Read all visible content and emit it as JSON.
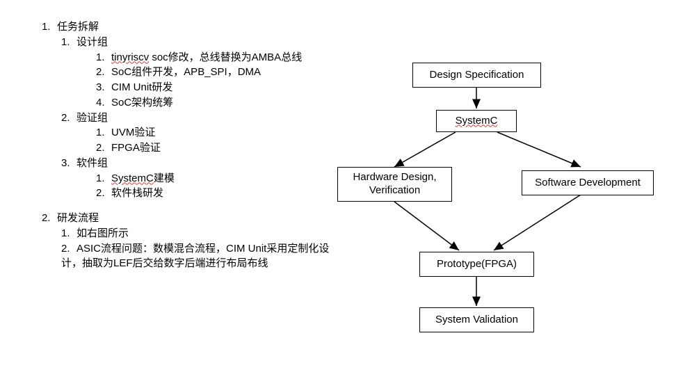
{
  "outline": {
    "items": [
      {
        "num": "1.",
        "label": "任务拆解",
        "children": [
          {
            "num": "1.",
            "label": "设计组",
            "children": [
              {
                "num": "1.",
                "label_prefix": "tinyriscv",
                "label_rest": " soc修改，总线替换为AMBA总线"
              },
              {
                "num": "2.",
                "label": "SoC组件开发，APB_SPI，DMA"
              },
              {
                "num": "3.",
                "label": "CIM Unit研发"
              },
              {
                "num": "4.",
                "label": "SoC架构统筹"
              }
            ]
          },
          {
            "num": "2.",
            "label": "验证组",
            "children": [
              {
                "num": "1.",
                "label": "UVM验证"
              },
              {
                "num": "2.",
                "label": "FPGA验证"
              }
            ]
          },
          {
            "num": "3.",
            "label": "软件组",
            "children": [
              {
                "num": "1.",
                "label_prefix": "SystemC",
                "label_rest": "建模"
              },
              {
                "num": "2.",
                "label": "软件栈研发"
              }
            ]
          }
        ]
      },
      {
        "num": "2.",
        "label": "研发流程",
        "children": [
          {
            "num": "1.",
            "label": "如右图所示"
          },
          {
            "num": "2.",
            "label": "ASIC流程问题：数模混合流程，CIM Unit采用定制化设计，抽取为LEF后交给数字后端进行布局布线"
          }
        ]
      }
    ]
  },
  "diagram": {
    "nodes": {
      "spec": "Design Specification",
      "systemc": "SystemC",
      "hw": "Hardware Design,\nVerification",
      "sw": "Software Development",
      "proto": "Prototype(FPGA)",
      "valid": "System Validation"
    }
  },
  "chart_data": {
    "type": "flowchart",
    "nodes": [
      {
        "id": "spec",
        "label": "Design Specification"
      },
      {
        "id": "systemc",
        "label": "SystemC"
      },
      {
        "id": "hw",
        "label": "Hardware Design, Verification"
      },
      {
        "id": "sw",
        "label": "Software Development"
      },
      {
        "id": "proto",
        "label": "Prototype(FPGA)"
      },
      {
        "id": "valid",
        "label": "System Validation"
      }
    ],
    "edges": [
      {
        "from": "spec",
        "to": "systemc"
      },
      {
        "from": "systemc",
        "to": "hw"
      },
      {
        "from": "systemc",
        "to": "sw"
      },
      {
        "from": "hw",
        "to": "proto"
      },
      {
        "from": "sw",
        "to": "proto"
      },
      {
        "from": "proto",
        "to": "valid"
      }
    ]
  }
}
